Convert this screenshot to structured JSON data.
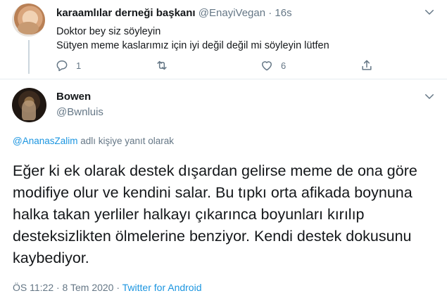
{
  "parent_tweet": {
    "display_name": "karaamlılar derneği başkanı",
    "handle": "@EnayiVegan",
    "separator": "·",
    "time": "16s",
    "lines": [
      "Doktor bey siz söyleyin",
      "Sütyen meme kaslarımız için iyi değil değil mi söyleyin lütfen"
    ],
    "reply_count": "1",
    "retweet_count": "",
    "like_count": "6"
  },
  "main_tweet": {
    "display_name": "Bowen",
    "handle": "@Bwnluis",
    "reply_to_handle": "@AnanasZalim",
    "reply_to_suffix": " adlı kişiye yanıt olarak",
    "text": "Eğer ki ek olarak destek dışardan gelirse meme de ona göre modifiye olur ve kendini salar. Bu tıpkı orta afikada boynuna halka takan yerliler halkayı çıkarınca boyunları kırılıp desteksizlikten ölmelerine benziyor. Kendi destek dokusunu kaybediyor.",
    "timestamp": "ÖS 11:22 · 8 Tem 2020 · ",
    "source": "Twitter for Android"
  },
  "colors": {
    "text": "#14171a",
    "muted": "#657786",
    "link": "#1b95e0",
    "divider": "#e6ecf0"
  },
  "icons": [
    "chevron-down-icon",
    "reply-icon",
    "retweet-icon",
    "like-icon",
    "share-icon"
  ]
}
